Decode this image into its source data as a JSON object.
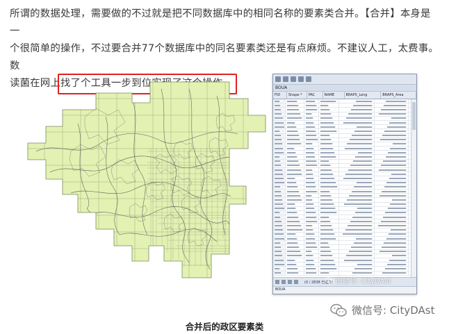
{
  "article": {
    "line1": "所谓的数据处理，需要做的不过就是把不同数据库中的相同名称的要素类合并。【合并】本身是一",
    "line2": "个很简单的操作，不过要合并77个数据库中的同名要素类还是有点麻烦。不建议人工，太费事。数",
    "line3_before": "读菌在网上",
    "line3_highlight": "找了个工具一步到位实现了这个操作。"
  },
  "attribute_table": {
    "title": "BOUA",
    "columns": [
      "FID",
      "Shape *",
      "PAC",
      "NAME",
      "BRAPS_Leng",
      "BRAPS_Area"
    ],
    "nav_count": "(0 / 2838 已选择)",
    "tab_label": "BOUA"
  },
  "watermark": {
    "small": "微信号: CityDAst",
    "large": "微信号: CityDAst"
  },
  "caption": "合并后的政区要素类",
  "colors": {
    "map_fill": "#e3f1b3",
    "map_stroke": "#5a5a5a",
    "highlight_box": "#e02020"
  },
  "icons": [
    "wechat-icon",
    "table-options-icon",
    "record-nav-icon"
  ]
}
